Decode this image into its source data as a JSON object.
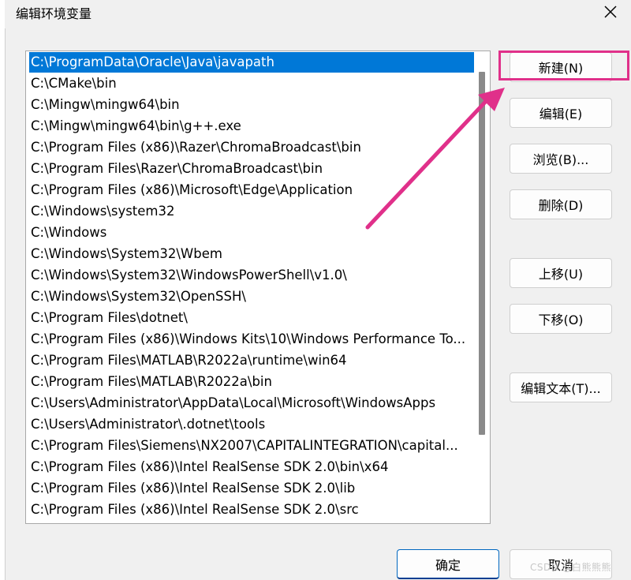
{
  "window": {
    "title": "编辑环境变量",
    "close_icon": "close-icon"
  },
  "path_list": {
    "selected_index": 0,
    "items": [
      "C:\\ProgramData\\Oracle\\Java\\javapath",
      "C:\\CMake\\bin",
      "C:\\Mingw\\mingw64\\bin",
      "C:\\Mingw\\mingw64\\bin\\g++.exe",
      "C:\\Program Files (x86)\\Razer\\ChromaBroadcast\\bin",
      "C:\\Program Files\\Razer\\ChromaBroadcast\\bin",
      "C:\\Program Files (x86)\\Microsoft\\Edge\\Application",
      "C:\\Windows\\system32",
      "C:\\Windows",
      "C:\\Windows\\System32\\Wbem",
      "C:\\Windows\\System32\\WindowsPowerShell\\v1.0\\",
      "C:\\Windows\\System32\\OpenSSH\\",
      "C:\\Program Files\\dotnet\\",
      "C:\\Program Files (x86)\\Windows Kits\\10\\Windows Performance To...",
      "C:\\Program Files\\MATLAB\\R2022a\\runtime\\win64",
      "C:\\Program Files\\MATLAB\\R2022a\\bin",
      "C:\\Users\\Administrator\\AppData\\Local\\Microsoft\\WindowsApps",
      "C:\\Users\\Administrator\\.dotnet\\tools",
      "C:\\Program Files\\Siemens\\NX2007\\CAPITALINTEGRATION\\capital...",
      "C:\\Program Files (x86)\\Intel RealSense SDK 2.0\\bin\\x64",
      "C:\\Program Files (x86)\\Intel RealSense SDK 2.0\\lib",
      "C:\\Program Files (x86)\\Intel RealSense SDK 2.0\\src"
    ]
  },
  "buttons": {
    "new": "新建(N)",
    "edit": "编辑(E)",
    "browse": "浏览(B)...",
    "delete": "删除(D)",
    "move_up": "上移(U)",
    "move_down": "下移(O)",
    "edit_text": "编辑文本(T)...",
    "ok": "确定",
    "cancel": "取消"
  },
  "annotation": {
    "color": "#e0308a"
  },
  "watermark": "CSDN @白熊熊熊",
  "colors": {
    "selection": "#0078d7",
    "background": "#f0f0f0"
  }
}
